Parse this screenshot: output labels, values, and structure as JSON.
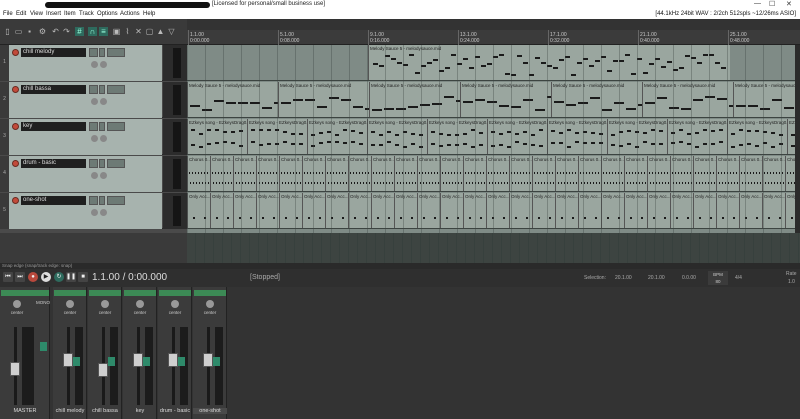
{
  "titlebar": {
    "license": "[Licensed for personal/small business use]",
    "minimize": "—",
    "maximize": "☐",
    "close": "✕"
  },
  "menu": [
    "File",
    "Edit",
    "View",
    "Insert",
    "Item",
    "Track",
    "Options",
    "Actions",
    "Help"
  ],
  "status": "[44.1kHz 24bit WAV : 2/2ch 512spls ~12/26ms ASIO]",
  "ruler": [
    {
      "bar": "1.1.00",
      "time": "0:00.000"
    },
    {
      "bar": "5.1.00",
      "time": "0:08.000"
    },
    {
      "bar": "9.1.00",
      "time": "0:16.000"
    },
    {
      "bar": "13.1.00",
      "time": "0:24.000"
    },
    {
      "bar": "17.1.00",
      "time": "0:32.000"
    },
    {
      "bar": "21.1.00",
      "time": "0:40.000"
    },
    {
      "bar": "25.1.00",
      "time": "0:48.000"
    }
  ],
  "tracks": [
    {
      "num": "1",
      "name": "chill melody"
    },
    {
      "num": "2",
      "name": "chill bassa"
    },
    {
      "num": "3",
      "name": "key"
    },
    {
      "num": "4",
      "name": "drum - basic"
    },
    {
      "num": "5",
      "name": "one-shot"
    }
  ],
  "items": {
    "melody": "Melody Sauce 5 - melodysauce.mid",
    "bass": "Melody Sauce 5 - melodysauce.mid",
    "key": "EZkeys song - EZkeysDrag0.mid",
    "drum": "Chorus 0...",
    "oneshot": "Only Acc..."
  },
  "statusline": "Snap edge (snap/track edge: snap)",
  "transport": {
    "position": "1.1.00 / 0:00.000",
    "state": "[Stopped]",
    "selection_label": "Selection:",
    "sel_start": "20.1.00",
    "sel_end": "20.1.00",
    "sel_len": "0.0.00",
    "bpm_label": "BPM",
    "bpm": "80",
    "sig": "4/4",
    "rate_label": "Rate",
    "rate": "1.0"
  },
  "master": {
    "label": "MASTER",
    "pan": "center",
    "mono": "MONO"
  },
  "mixer": [
    {
      "name": "chill melody",
      "pan": "center"
    },
    {
      "name": "chill bassa",
      "pan": "center"
    },
    {
      "name": "key",
      "pan": "center"
    },
    {
      "name": "drum - basic",
      "pan": "center"
    },
    {
      "name": "one-shot",
      "pan": "center"
    }
  ],
  "colors": {
    "accent": "#2e6b5e",
    "record": "#c24a3a",
    "header_green": "#3c8a55",
    "item_bg": "#9aa69f"
  }
}
